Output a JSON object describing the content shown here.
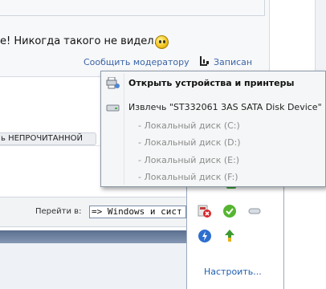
{
  "forum": {
    "post_text": "е! Никогда такого не видел...",
    "report_link": "Сообщить модератору",
    "notes_link": "Записан",
    "unread_button": "ь НЕПРОЧИТАННОЙ",
    "jump_label": "Перейти в:",
    "jump_select_value": "=> Windows и сист"
  },
  "context_menu": {
    "items": [
      {
        "label": "Открыть устройства и принтеры",
        "style": "bold",
        "icon": "devices-printers-icon"
      },
      {
        "label": "Извлечь \"ST332061 3AS SATA Disk Device\"",
        "style": "normal",
        "icon": "disk-drive-icon"
      },
      {
        "label": "- Локальный диск (C:)",
        "style": "disabled"
      },
      {
        "label": "- Локальный диск (D:)",
        "style": "disabled"
      },
      {
        "label": "- Локальный диск (E:)",
        "style": "disabled"
      },
      {
        "label": "- Локальный диск (F:)",
        "style": "disabled"
      }
    ]
  },
  "tray": {
    "customize_link": "Настроить...",
    "icons": [
      "green-tray-icon",
      "power-alert-icon",
      "green-check-icon",
      "device-icon",
      "lightning-icon",
      "update-arrow-icon"
    ]
  },
  "colors": {
    "link": "#3b64a6",
    "customize_link": "#1f5fb0",
    "menu_background": "#f5f6f7",
    "disabled_text": "#8c8c8c"
  }
}
